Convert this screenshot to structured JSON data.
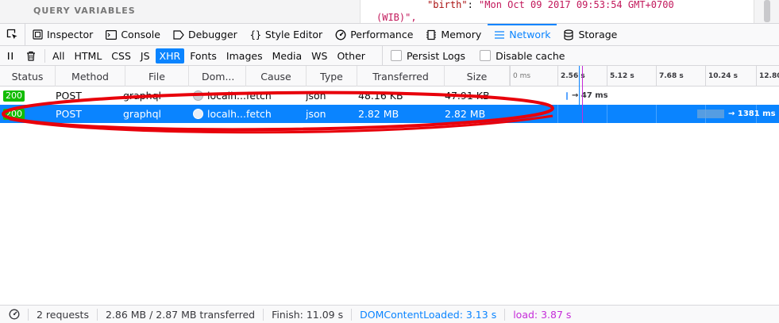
{
  "background": {
    "query_variables_title": "QUERY VARIABLES",
    "code_line_1_key": "\"birth\"",
    "code_line_1_value": "\"Mon Oct 09 2017 09:53:54 GMT+0700",
    "code_line_2": "(WIB)\","
  },
  "tabs": [
    {
      "label": "Inspector",
      "icon": "inspector-icon"
    },
    {
      "label": "Console",
      "icon": "console-icon"
    },
    {
      "label": "Debugger",
      "icon": "debugger-icon"
    },
    {
      "label": "Style Editor",
      "icon": "style-editor-icon"
    },
    {
      "label": "Performance",
      "icon": "performance-icon"
    },
    {
      "label": "Memory",
      "icon": "memory-icon"
    },
    {
      "label": "Network",
      "icon": "network-icon"
    },
    {
      "label": "Storage",
      "icon": "storage-icon"
    }
  ],
  "selected_tab": "Network",
  "filters": [
    "All",
    "HTML",
    "CSS",
    "JS",
    "XHR",
    "Fonts",
    "Images",
    "Media",
    "WS",
    "Other"
  ],
  "selected_filter": "XHR",
  "options": {
    "persist_logs": "Persist Logs",
    "disable_cache": "Disable cache"
  },
  "columns": {
    "status": "Status",
    "method": "Method",
    "file": "File",
    "domain": "Dom...",
    "cause": "Cause",
    "type": "Type",
    "transferred": "Transferred",
    "size": "Size"
  },
  "waterfall_ticks": [
    "0 ms",
    "2.56 s",
    "5.12 s",
    "7.68 s",
    "10.24 s",
    "12.80"
  ],
  "requests": [
    {
      "status": "200",
      "method": "POST",
      "file": "graphql",
      "domain": "localh...",
      "cause": "fetch",
      "type": "json",
      "transferred": "48.16 KB",
      "size": "47.91 KB",
      "timing": "→ 47 ms"
    },
    {
      "status": "200",
      "method": "POST",
      "file": "graphql",
      "domain": "localh...",
      "cause": "fetch",
      "type": "json",
      "transferred": "2.82 MB",
      "size": "2.82 MB",
      "timing": "→ 1381 ms"
    }
  ],
  "statusbar": {
    "requests": "2 requests",
    "transferred": "2.86 MB / 2.87 MB transferred",
    "finish": "Finish: 11.09 s",
    "dom_content_loaded": "DOMContentLoaded: 3.13 s",
    "load": "load: 3.87 s"
  },
  "colors": {
    "accent": "#0a84ff",
    "status_ok": "#12bc00",
    "load_marker": "#c52bd9",
    "annotation": "#e8000b"
  }
}
